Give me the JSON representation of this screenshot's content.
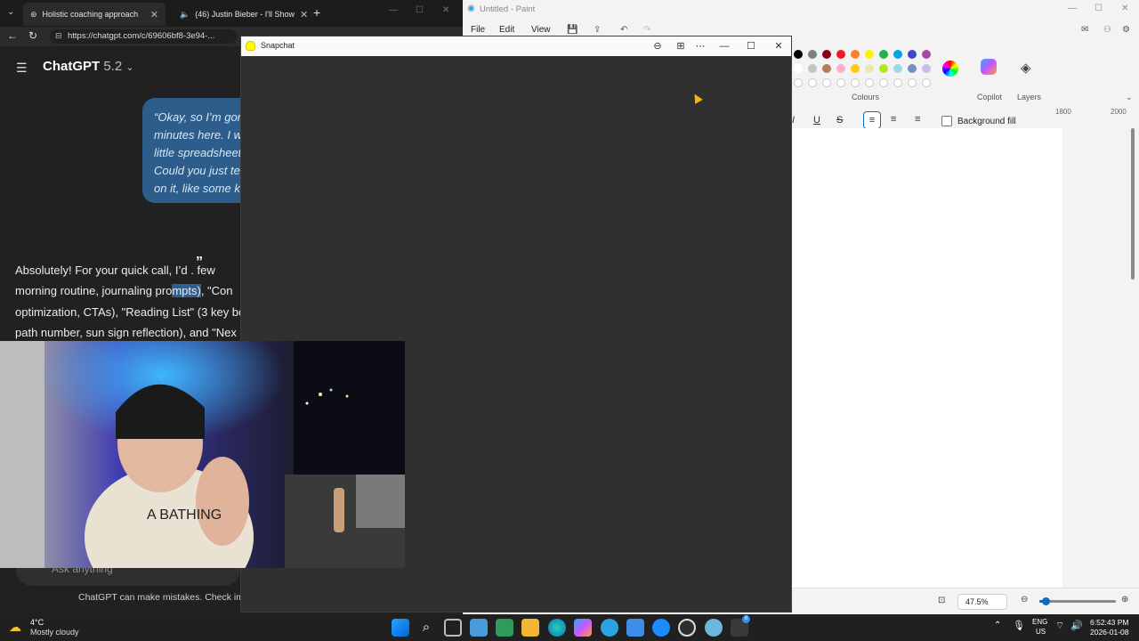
{
  "browser": {
    "tabs": [
      {
        "label": "Holistic coaching approach",
        "active": true
      },
      {
        "label": "(46) Justin Bieber - I'll Show",
        "active": false
      }
    ],
    "url": "https://chatgpt.com/c/69606bf8-3e94-..."
  },
  "chat": {
    "title": "ChatGPT",
    "version": "5.2",
    "user_message_lines": [
      "“Okay, so I’m gon",
      "minutes here. I w",
      "little spreadsheet",
      "Could you just te",
      "on it, like some k"
    ],
    "assistant_lines": [
      {
        "pre": "Absolutely! For your quick call, I’d ",
        "hl": "",
        "post": "  . few"
      },
      {
        "pre": "morning routine, journaling pro",
        "hl": "mpts)",
        "post": ", \"Con"
      },
      {
        "pre": "optimization, CTAs), \"Reading List\" (3 key bo",
        "hl": "",
        "post": ""
      },
      {
        "pre": "path number, sun sign reflection), and \"Nex",
        "hl": "",
        "post": ""
      }
    ],
    "quote_popup": "”",
    "input_placeholder": "Ask anything",
    "disclaimer": "ChatGPT can make mistakes. Check impo"
  },
  "paint": {
    "title": "Untitled - Paint",
    "menu": [
      "File",
      "Edit",
      "View"
    ],
    "colours_label": "Colours",
    "copilot_label": "Copilot",
    "layers_label": "Layers",
    "background_fill_label": "Background fill",
    "ruler_labels": [
      "1800",
      "2000"
    ],
    "zoom": "47.5%",
    "zoom_fraction": 0.08,
    "palette_row1": [
      "#000000",
      "#7f7f7f",
      "#880015",
      "#ed1c24",
      "#ff7f27",
      "#fff200",
      "#22b14c",
      "#00a2e8",
      "#3f48cc",
      "#a349a4"
    ],
    "palette_row2": [
      "#ffffff",
      "#c3c3c3",
      "#b97a57",
      "#ffaec9",
      "#ffc90e",
      "#efe4b0",
      "#b5e61d",
      "#99d9ea",
      "#7092be",
      "#c8bfe7"
    ]
  },
  "snapchat": {
    "title": "Snapchat"
  },
  "taskbar": {
    "weather_temp": "4°C",
    "weather_condition": "Mostly cloudy",
    "lang_line1": "ENG",
    "lang_line2": "US",
    "time": "6:52:43 PM",
    "date": "2026-01-08",
    "badge_count": "8"
  }
}
